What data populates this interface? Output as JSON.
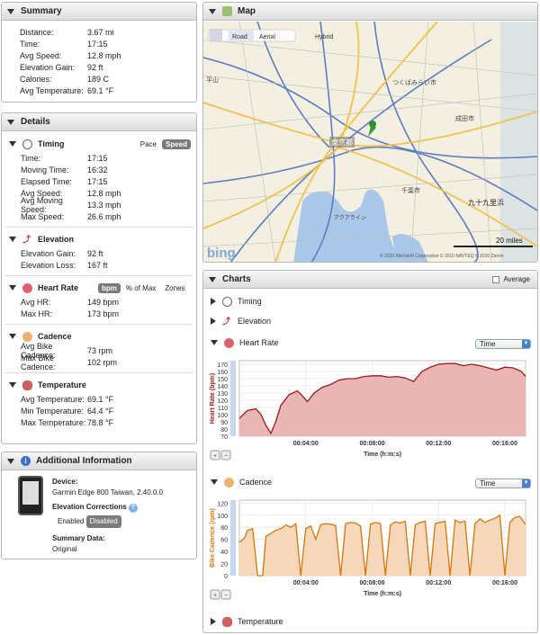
{
  "summary": {
    "title": "Summary",
    "rows": [
      {
        "k": "Distance:",
        "v": "3.67 mi"
      },
      {
        "k": "Time:",
        "v": "17:15"
      },
      {
        "k": "Avg Speed:",
        "v": "12.8 mph"
      },
      {
        "k": "Elevation Gain:",
        "v": "92 ft"
      },
      {
        "k": "Calories:",
        "v": "189 C"
      },
      {
        "k": "Avg Temperature:",
        "v": "69.1 °F"
      }
    ]
  },
  "details": {
    "title": "Details",
    "timing": {
      "label": "Timing",
      "pace": "Pace",
      "speed": "Speed",
      "rows": [
        {
          "k": "Time:",
          "v": "17:15"
        },
        {
          "k": "Moving Time:",
          "v": "16:32"
        },
        {
          "k": "Elapsed Time:",
          "v": "17:15"
        },
        {
          "k": "Avg Speed:",
          "v": "12.8 mph"
        },
        {
          "k": "Avg Moving Speed:",
          "v": "13.3 mph"
        },
        {
          "k": "Max Speed:",
          "v": "26.6 mph"
        }
      ]
    },
    "elevation": {
      "label": "Elevation",
      "rows": [
        {
          "k": "Elevation Gain:",
          "v": "92 ft"
        },
        {
          "k": "Elevation Loss:",
          "v": "167 ft"
        }
      ]
    },
    "heartrate": {
      "label": "Heart Rate",
      "bpm": "bpm",
      "pctmax": "% of Max",
      "zones": "Zones",
      "rows": [
        {
          "k": "Avg HR:",
          "v": "149 bpm"
        },
        {
          "k": "Max HR:",
          "v": "173 bpm"
        }
      ]
    },
    "cadence": {
      "label": "Cadence",
      "rows": [
        {
          "k": "Avg Bike Cadence:",
          "v": "73 rpm"
        },
        {
          "k": "Max Bike Cadence:",
          "v": "102 rpm"
        }
      ]
    },
    "temperature": {
      "label": "Temperature",
      "rows": [
        {
          "k": "Avg Temperature:",
          "v": "69.1 °F"
        },
        {
          "k": "Min Temperature:",
          "v": "64.4 °F"
        },
        {
          "k": "Max Temperature:",
          "v": "78.8 °F"
        }
      ]
    }
  },
  "info": {
    "title": "Additional Information",
    "device_label": "Device:",
    "device": "Garmin Edge 800 Taiwan, 2.40.0.0",
    "elev_corr_label": "Elevation Corrections",
    "enabled": "Enabled",
    "disabled": "Disabled",
    "summary_label": "Summary Data:",
    "summary_val": "Original"
  },
  "map": {
    "title": "Map",
    "tabs": [
      "Road",
      "Aerial",
      "Hybrid"
    ],
    "scale": "20 miles",
    "logo": "bing",
    "copyright": "© 2010 Microsoft Corporation  © 2010 NAVTEQ  © 2010 Zenrin",
    "labels": [
      "つくばみらい市",
      "東京都",
      "九十九里浜",
      "成田市",
      "千葉市",
      "アクアライン",
      "平山"
    ]
  },
  "charts": {
    "title": "Charts",
    "average": "Average",
    "timing": "Timing",
    "elevation": "Elevation",
    "heartrate": "Heart Rate",
    "cadence": "Cadence",
    "temperature": "Temperature",
    "select": "Time"
  },
  "chart_data": [
    {
      "type": "area",
      "title": "Heart Rate",
      "ylabel": "Heart Rate (bpm)",
      "xlabel": "Time (h:m:s)",
      "ylim": [
        70,
        175
      ],
      "yticks": [
        70,
        80,
        90,
        100,
        110,
        120,
        130,
        140,
        150,
        160,
        170
      ],
      "xticks": [
        "00:04:00",
        "00:08:00",
        "00:12:00",
        "00:16:00"
      ],
      "xlim": [
        0,
        17.25
      ],
      "x": [
        0,
        0.5,
        1,
        1.3,
        1.6,
        1.9,
        2.2,
        2.5,
        3,
        3.5,
        3.8,
        4.1,
        4.5,
        5,
        5.5,
        6,
        6.5,
        7,
        7.5,
        8,
        8.5,
        9,
        9.5,
        10,
        10.5,
        11,
        11.5,
        12,
        12.5,
        13,
        13.5,
        14,
        14.5,
        15,
        15.5,
        16,
        16.5,
        17,
        17.25
      ],
      "y": [
        95,
        106,
        108,
        100,
        85,
        74,
        91,
        113,
        128,
        133,
        126,
        118,
        130,
        138,
        142,
        148,
        150,
        150,
        153,
        154,
        154,
        152,
        153,
        151,
        146,
        160,
        166,
        170,
        171,
        171,
        168,
        170,
        168,
        165,
        162,
        166,
        165,
        160,
        153
      ]
    },
    {
      "type": "area",
      "title": "Cadence",
      "ylabel": "Bike Cadence (rpm)",
      "xlabel": "Time (h:m:s)",
      "ylim": [
        0,
        125
      ],
      "yticks": [
        0,
        20,
        40,
        60,
        80,
        100,
        120
      ],
      "xticks": [
        "00:04:00",
        "00:08:00",
        "00:12:00",
        "00:16:00"
      ],
      "xlim": [
        0,
        17.25
      ],
      "x": [
        0,
        0.3,
        0.5,
        0.8,
        1.1,
        1.4,
        1.6,
        1.9,
        2.2,
        2.5,
        2.8,
        3.1,
        3.4,
        3.7,
        4.0,
        4.3,
        4.6,
        4.9,
        5.2,
        5.5,
        5.8,
        6.1,
        6.4,
        6.7,
        7.0,
        7.3,
        7.6,
        7.9,
        8.2,
        8.5,
        8.8,
        9.1,
        9.4,
        9.7,
        10.0,
        10.3,
        10.6,
        10.9,
        11.2,
        11.5,
        11.8,
        12.1,
        12.4,
        12.7,
        13.0,
        13.3,
        13.6,
        13.9,
        14.2,
        14.5,
        14.8,
        15.1,
        15.4,
        15.7,
        16.0,
        16.3,
        16.6,
        16.9,
        17.25
      ],
      "y": [
        55,
        62,
        75,
        78,
        0,
        0,
        65,
        70,
        75,
        78,
        84,
        80,
        86,
        0,
        78,
        82,
        60,
        84,
        86,
        85,
        83,
        0,
        86,
        88,
        87,
        82,
        0,
        85,
        88,
        86,
        0,
        84,
        89,
        87,
        90,
        0,
        84,
        88,
        90,
        0,
        86,
        88,
        90,
        0,
        92,
        88,
        90,
        0,
        86,
        94,
        88,
        92,
        95,
        100,
        0,
        88,
        96,
        98,
        85
      ]
    }
  ]
}
